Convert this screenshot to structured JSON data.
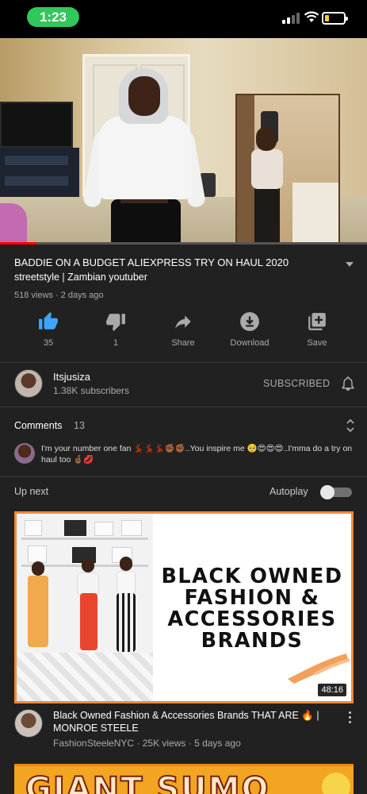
{
  "status_bar": {
    "time": "1:23"
  },
  "video": {
    "progress_fraction": 0.1,
    "title": "BADDIE ON A BUDGET ALIEXPRESS TRY ON HAUL 2020",
    "subtitle": "streetstyle | Zambian youtuber",
    "views_line": "518 views · 2 days ago"
  },
  "actions": [
    {
      "icon": "like-icon",
      "label": "35"
    },
    {
      "icon": "dislike-icon",
      "label": "1"
    },
    {
      "icon": "share-icon",
      "label": "Share"
    },
    {
      "icon": "download-icon",
      "label": "Download"
    },
    {
      "icon": "save-icon",
      "label": "Save"
    }
  ],
  "channel": {
    "name": "Itsjusiza",
    "subscribers": "1.38K subscribers",
    "subscribe_state": "SUBSCRIBED"
  },
  "comments": {
    "label": "Comments",
    "count": "13",
    "top_comment": "I'm your number one fan 💃🏿💃🏿💃🏿✊🏾✊🏾..You inspire me 🥺😍😍😍..I'mma do a try on haul too 🤞🏾💋"
  },
  "up_next": {
    "label": "Up next",
    "autoplay_label": "Autoplay",
    "autoplay_on": false
  },
  "recommended": {
    "thumbnail_text": "BLACK OWNED FASHION & ACCESSORIES BRANDS",
    "duration": "48:16",
    "title": "Black Owned Fashion & Accessories Brands THAT ARE 🔥 | MONROE STEELE",
    "meta": "FashionSteeleNYC · 25K views · 5 days ago",
    "colors": {
      "frame": "#f08a3c"
    }
  },
  "next_thumbnail_text": "GIANT SUMO"
}
